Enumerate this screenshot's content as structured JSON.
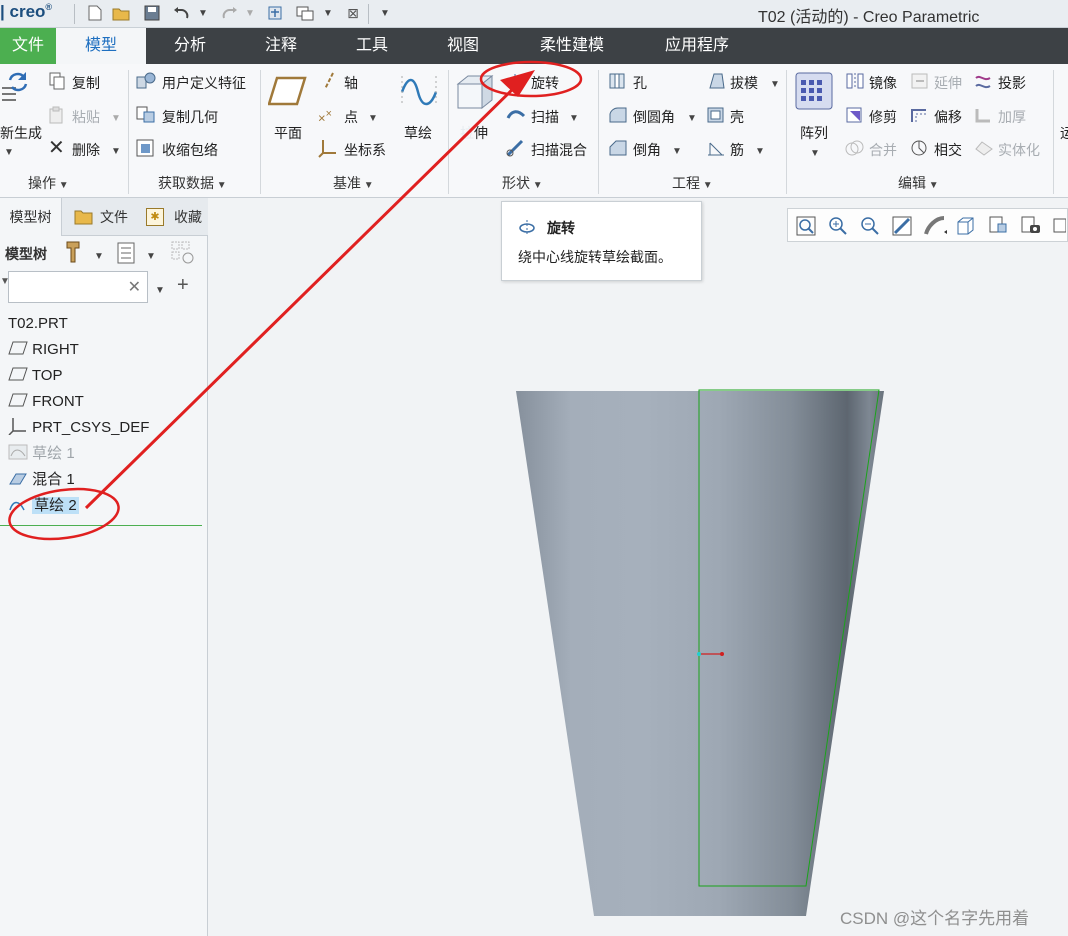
{
  "titlebar": {
    "logo": "creo",
    "title": "T02 (活动的) - Creo Parametric"
  },
  "tabs": [
    "文件",
    "模型",
    "分析",
    "注释",
    "工具",
    "视图",
    "柔性建模",
    "应用程序"
  ],
  "ribbon": {
    "operations": {
      "regenerate": "新生成",
      "copy": "复制",
      "paste": "粘贴",
      "delete": "删除",
      "group": "操作"
    },
    "getdata": {
      "udf": "用户定义特征",
      "copygeom": "复制几何",
      "shrinkwrap": "收缩包络",
      "group": "获取数据"
    },
    "datum": {
      "plane": "平面",
      "axis": "轴",
      "point": "点",
      "csys": "坐标系",
      "sketch": "草绘",
      "group": "基准"
    },
    "shapes": {
      "extrude": "拉伸",
      "revolve": "旋转",
      "sweep": "扫描",
      "sweptblend": "扫描混合",
      "group": "形状"
    },
    "engineering": {
      "hole": "孔",
      "round": "倒圆角",
      "chamfer": "倒角",
      "draft": "拔模",
      "shell": "壳",
      "rib": "筋",
      "group": "工程"
    },
    "editing": {
      "pattern": "阵列",
      "mirror": "镜像",
      "trim": "修剪",
      "merge": "合并",
      "extend": "延伸",
      "offset": "偏移",
      "intersect": "相交",
      "project": "投影",
      "thicken": "加厚",
      "solidify": "实体化",
      "group": "编辑"
    },
    "overflow": "运"
  },
  "leftpanel": {
    "tabs": [
      "模型树",
      "文件",
      "收藏"
    ],
    "header": "模型树",
    "search_placeholder": "",
    "tree": [
      "T02.PRT",
      "RIGHT",
      "TOP",
      "FRONT",
      "PRT_CSYS_DEF",
      "草绘 1",
      "混合 1",
      "草绘 2"
    ]
  },
  "tooltip": {
    "title": "旋转",
    "desc": "绕中心线旋转草绘截面。"
  },
  "watermark": "CSDN @这个名字先用着",
  "colors": {
    "accent_green": "#4caf50",
    "tab_dark": "#3d4145",
    "annotation_red": "#e02020",
    "model_body": "#9aa4b0",
    "sketch_green": "#1aa31a"
  }
}
